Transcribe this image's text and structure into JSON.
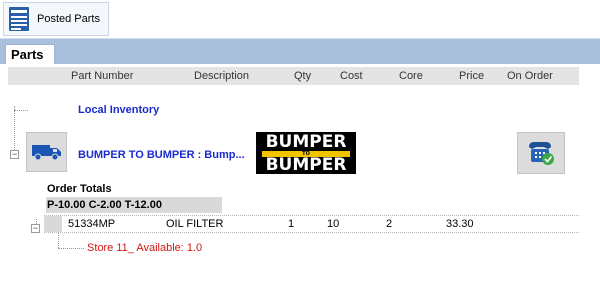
{
  "toolbar": {
    "posted_parts_label": "Posted Parts"
  },
  "tabs": [
    {
      "label": "Parts",
      "active": true
    }
  ],
  "grid": {
    "columns": [
      "Part Number",
      "Description",
      "Qty",
      "Cost",
      "Core",
      "Price",
      "On Order"
    ]
  },
  "tree": {
    "local_inventory_label": "Local Inventory",
    "vendor": {
      "name": "BUMPER TO BUMPER : Bump...",
      "logo": {
        "line1": "BUMPER",
        "line2": "TO",
        "line3": "BUMPER"
      },
      "truck_icon": "truck-icon",
      "phone_icon": "phone-check-icon"
    },
    "order_totals": {
      "label": "Order Totals",
      "summary": "P-10.00 C-2.00 T-12.00"
    },
    "part": {
      "part_number": "51334MP",
      "description": "OIL FILTER",
      "qty": "1",
      "cost": "10",
      "core": "2",
      "price": "33.30",
      "on_order": ""
    },
    "store_line": "Store 11_ Available: 1.0"
  },
  "colors": {
    "tab_strip": "#a9bfdb",
    "link_blue": "#1a2bcf",
    "store_red": "#d01515",
    "header_gray": "#e4e4e4"
  }
}
